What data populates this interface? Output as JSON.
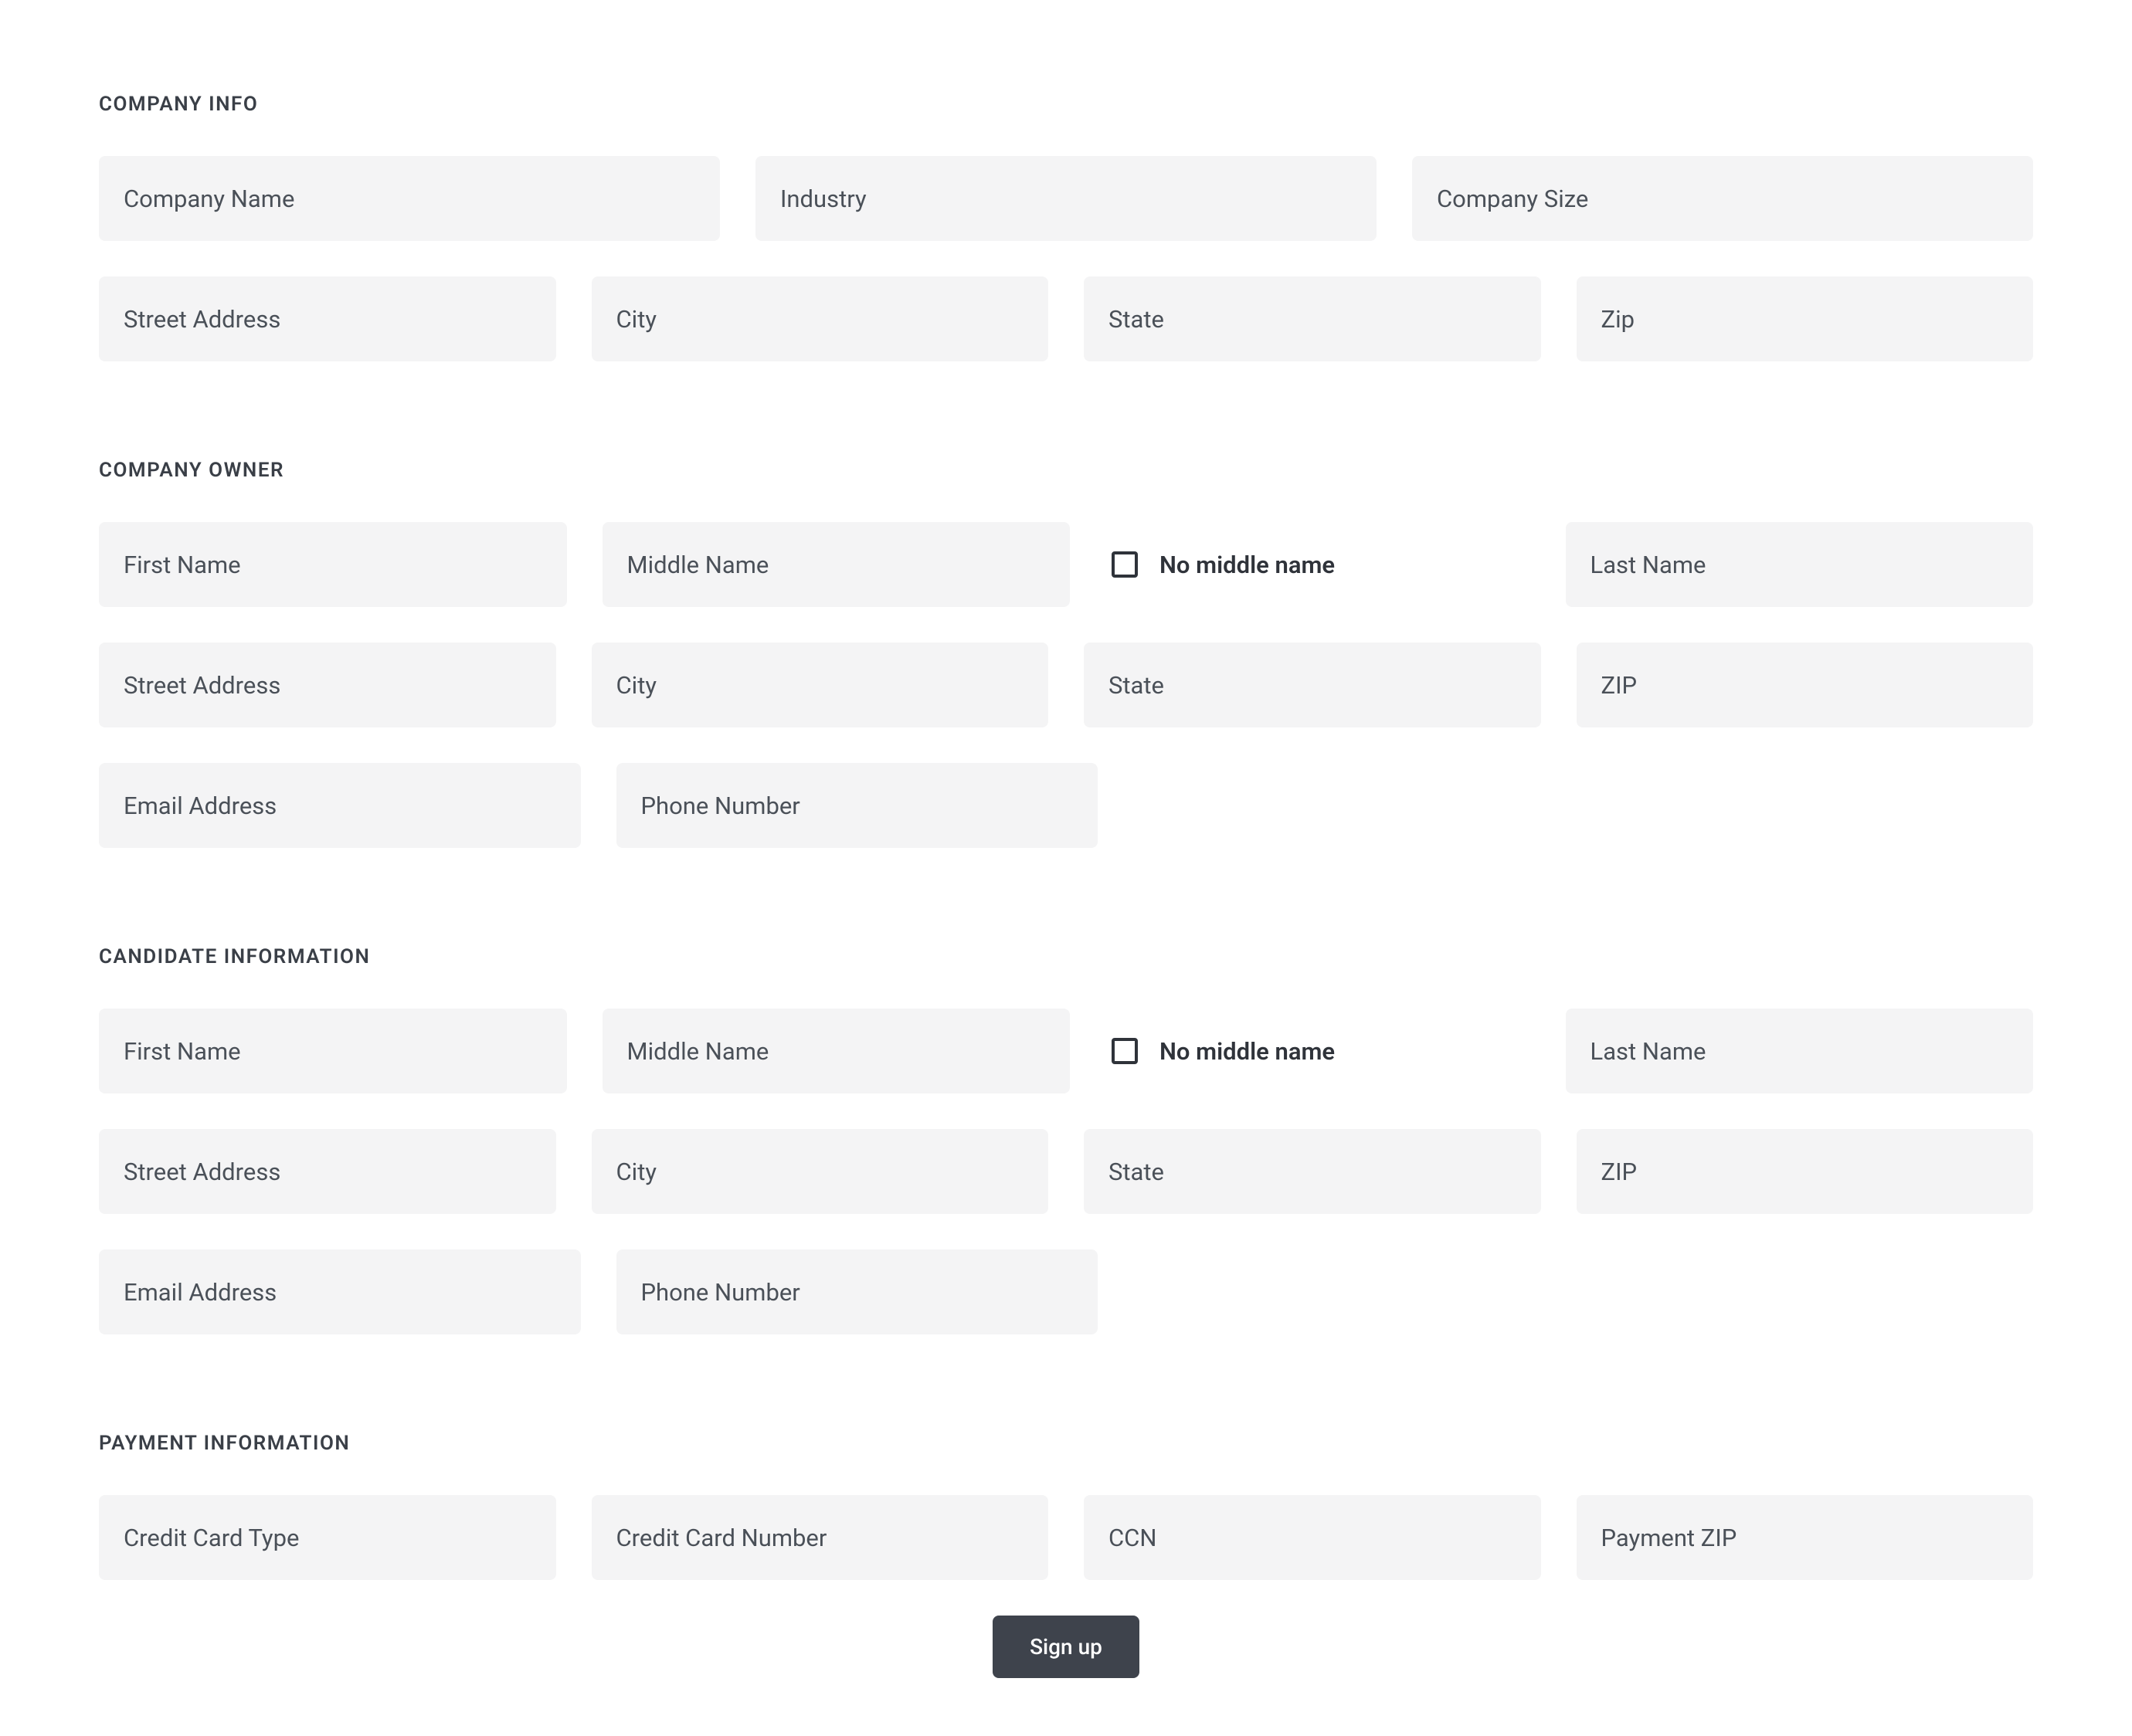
{
  "sections": {
    "companyInfo": {
      "header": "COMPANY INFO",
      "companyName": {
        "placeholder": "Company Name",
        "value": ""
      },
      "industry": {
        "placeholder": "Industry",
        "value": ""
      },
      "companySize": {
        "placeholder": "Company Size",
        "value": ""
      },
      "streetAddress": {
        "placeholder": "Street Address",
        "value": ""
      },
      "city": {
        "placeholder": "City",
        "value": ""
      },
      "state": {
        "placeholder": "State",
        "value": ""
      },
      "zip": {
        "placeholder": "Zip",
        "value": ""
      }
    },
    "companyOwner": {
      "header": "COMPANY OWNER",
      "firstName": {
        "placeholder": "First Name",
        "value": ""
      },
      "middleName": {
        "placeholder": "Middle Name",
        "value": ""
      },
      "noMiddleName": {
        "label": "No middle name",
        "checked": false
      },
      "lastName": {
        "placeholder": "Last Name",
        "value": ""
      },
      "streetAddress": {
        "placeholder": "Street Address",
        "value": ""
      },
      "city": {
        "placeholder": "City",
        "value": ""
      },
      "state": {
        "placeholder": "State",
        "value": ""
      },
      "zip": {
        "placeholder": "ZIP",
        "value": ""
      },
      "email": {
        "placeholder": "Email Address",
        "value": ""
      },
      "phone": {
        "placeholder": "Phone Number",
        "value": ""
      }
    },
    "candidate": {
      "header": "CANDIDATE INFORMATION",
      "firstName": {
        "placeholder": "First Name",
        "value": ""
      },
      "middleName": {
        "placeholder": "Middle Name",
        "value": ""
      },
      "noMiddleName": {
        "label": "No middle name",
        "checked": false
      },
      "lastName": {
        "placeholder": "Last Name",
        "value": ""
      },
      "streetAddress": {
        "placeholder": "Street Address",
        "value": ""
      },
      "city": {
        "placeholder": "City",
        "value": ""
      },
      "state": {
        "placeholder": "State",
        "value": ""
      },
      "zip": {
        "placeholder": "ZIP",
        "value": ""
      },
      "email": {
        "placeholder": "Email Address",
        "value": ""
      },
      "phone": {
        "placeholder": "Phone Number",
        "value": ""
      }
    },
    "payment": {
      "header": "PAYMENT INFORMATION",
      "cardType": {
        "placeholder": "Credit Card Type",
        "value": ""
      },
      "cardNumber": {
        "placeholder": "Credit Card Number",
        "value": ""
      },
      "ccn": {
        "placeholder": "CCN",
        "value": ""
      },
      "paymentZip": {
        "placeholder": "Payment ZIP",
        "value": ""
      }
    }
  },
  "actions": {
    "signup": "Sign up"
  }
}
